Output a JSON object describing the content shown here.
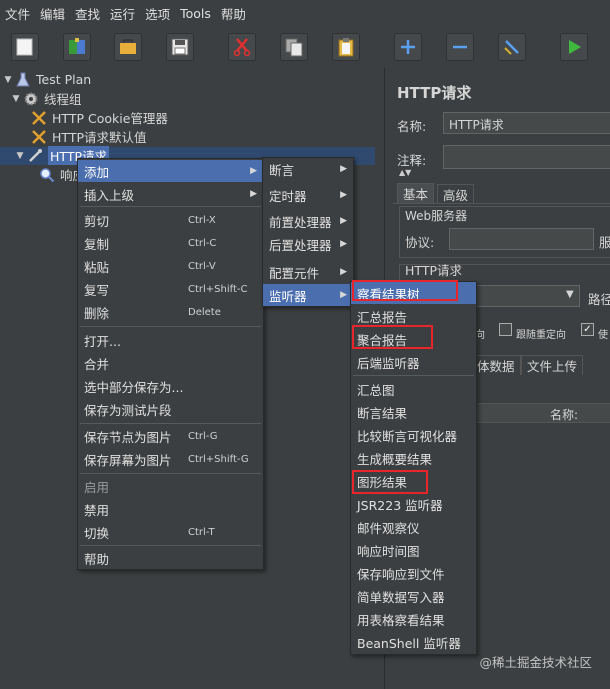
{
  "menubar": {
    "items": [
      "文件",
      "编辑",
      "查找",
      "运行",
      "选项",
      "Tools",
      "帮助"
    ]
  },
  "toolbar": {
    "buttons": [
      "new-icon",
      "templates-icon",
      "open-icon",
      "save-icon",
      "cut-icon",
      "copy-icon",
      "paste-icon",
      "expand-icon",
      "collapse-icon",
      "toggle-icon",
      "start-icon"
    ]
  },
  "tree": {
    "test_plan": "Test Plan",
    "thread_group": "线程组",
    "cookie_manager": "HTTP Cookie管理器",
    "request_defaults": "HTTP请求默认值",
    "http_request": "HTTP请求",
    "listener_partial": "响应"
  },
  "right_panel": {
    "title": "HTTP请求",
    "name_label": "名称:",
    "name_value": "HTTP请求",
    "comment_label": "注释:",
    "tab_basic": "基本",
    "tab_advanced": "高级",
    "web_server": "Web服务器",
    "protocol_label": "协议:",
    "protocol_clip": "服",
    "http_request_section": "HTTP请求",
    "path_label": "路径",
    "check_redirect_suffix": "向",
    "check_follow_redirect": "跟随重定向",
    "check_use": "使",
    "tab_body_suffix": "体数据",
    "tab_file_upload": "文件上传",
    "col_name": "名称:"
  },
  "context_menu": {
    "items": [
      {
        "label": "添加"
      },
      {
        "label": "插入上级"
      },
      {
        "label": "剪切",
        "shortcut": "Ctrl-X"
      },
      {
        "label": "复制",
        "shortcut": "Ctrl-C"
      },
      {
        "label": "粘贴",
        "shortcut": "Ctrl-V"
      },
      {
        "label": "复写",
        "shortcut": "Ctrl+Shift-C"
      },
      {
        "label": "删除",
        "shortcut": "Delete"
      },
      {
        "label": "打开..."
      },
      {
        "label": "合并"
      },
      {
        "label": "选中部分保存为..."
      },
      {
        "label": "保存为测试片段"
      },
      {
        "label": "保存节点为图片",
        "shortcut": "Ctrl-G"
      },
      {
        "label": "保存屏幕为图片",
        "shortcut": "Ctrl+Shift-G"
      },
      {
        "label": "启用"
      },
      {
        "label": "禁用"
      },
      {
        "label": "切换",
        "shortcut": "Ctrl-T"
      },
      {
        "label": "帮助"
      }
    ]
  },
  "add_submenu": {
    "items": [
      "断言",
      "定时器",
      "前置处理器",
      "后置处理器",
      "配置元件",
      "监听器"
    ]
  },
  "listener_submenu": {
    "items": [
      "察看结果树",
      "汇总报告",
      "聚合报告",
      "后端监听器",
      "汇总图",
      "断言结果",
      "比较断言可视化器",
      "生成概要结果",
      "图形结果",
      "JSR223 监听器",
      "邮件观察仪",
      "响应时间图",
      "保存响应到文件",
      "简单数据写入器",
      "用表格察看结果",
      "BeanShell 监听器"
    ]
  },
  "colors": {
    "background": "#3c3f41",
    "selection": "#4b6eaf",
    "highlight_box": "#e8252b"
  },
  "watermark": "@稀土掘金技术社区"
}
